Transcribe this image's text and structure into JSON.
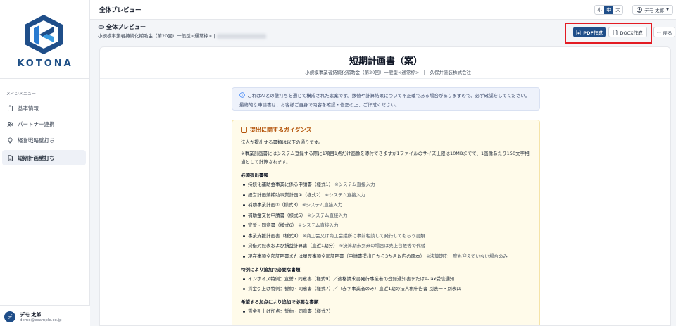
{
  "brand": {
    "name": "KOTONA",
    "colors": {
      "primary": "#1f4e89",
      "highlight": "#e31b23",
      "guidance_bg": "#fffbea"
    }
  },
  "sidebar": {
    "caption": "メインメニュー",
    "items": [
      {
        "label": "基本情報",
        "icon": "clipboard-icon",
        "active": false
      },
      {
        "label": "パートナー連携",
        "icon": "users-icon",
        "active": false
      },
      {
        "label": "経営戦略壁打ち",
        "icon": "lightbulb-icon",
        "active": false
      },
      {
        "label": "短期計画壁打ち",
        "icon": "document-icon",
        "active": true
      }
    ],
    "user": {
      "avatar": "デ",
      "name": "デモ 太郎",
      "email": "demo@example.co.jp"
    }
  },
  "topbar": {
    "title": "全体プレビュー",
    "sizes": [
      "小",
      "中",
      "大"
    ],
    "size_selected": "中",
    "user_menu": "デモ 太郎"
  },
  "preview": {
    "title": "全体プレビュー",
    "subtitle": "小規模事業者持続化補助金（第20回）一般型<通常枠> |",
    "pdf_label": "PDF作成",
    "docx_label": "DOCX作成",
    "back_label": "戻る"
  },
  "document": {
    "title": "短期計画書（案）",
    "subtitle": "小規模事業者持続化補助金（第20回）一般型<通常枠>　|　久保井塗装株式会社",
    "notice": "これはAIとの壁打ちを通じて構成された素案です。数値や計算結果について不正確である場合がありますので、必ず確認をしてください。最終的な申請書は、お客様ご自身で内容を確認・修正の上、ご作成ください。",
    "guidance": {
      "heading": "提出に関するガイダンス",
      "intro": "法人が提出する書類は以下の通りです。",
      "note": "※事業計画書にはシステム登録する際に1項目1点だけ画像を添付できますが1ファイルのサイズ上限は10MBまでで、1画像あたり150文字相当として計算されます。",
      "sections": [
        {
          "title": "必須提出書類",
          "items": [
            {
              "text": "持続化補助金事業に係る申請書（様式1）",
              "note": "※システム直接入力"
            },
            {
              "text": "経営計画兼補助事業計画①（様式2）",
              "note": "※システム直接入力"
            },
            {
              "text": "補助事業計画②（様式3）",
              "note": "※システム直接入力"
            },
            {
              "text": "補助金交付申請書（様式5）",
              "note": "※システム直接入力"
            },
            {
              "text": "宣誓・同意書（様式6）",
              "note": "※システム直接入力"
            },
            {
              "text": "事業支援計画書（様式4）",
              "note": "※商工会又は商工会議所に事前相談して発行してもらう書類"
            },
            {
              "text": "貸借対照表および損益計算書（直近1期分）",
              "note": "※決算期未到来の場合は売上台帳等で代替"
            },
            {
              "text": "現在事項全部証明書または履歴事項全部証明書（申請書提出日から3か月以内の原本）",
              "note": "※決算期を一度も迎えていない場合のみ"
            }
          ]
        },
        {
          "title": "特例により追加で必要な書類",
          "items": [
            {
              "text": "インボイス特例：宣誓・同意書（様式9）／適格請求書発行事業者の登録通知書またはe-Tax受信通知",
              "note": ""
            },
            {
              "text": "賃金引上げ特例：誓約・同意書（様式7）／（赤字事業者のみ）直近1期の法人税申告書 別表一・別表四",
              "note": ""
            }
          ]
        },
        {
          "title": "希望する加点により追加で必要な書類",
          "items": [
            {
              "text": "賃金引上げ加点：誓約・同意書（様式7）",
              "note": ""
            }
          ]
        }
      ]
    }
  }
}
